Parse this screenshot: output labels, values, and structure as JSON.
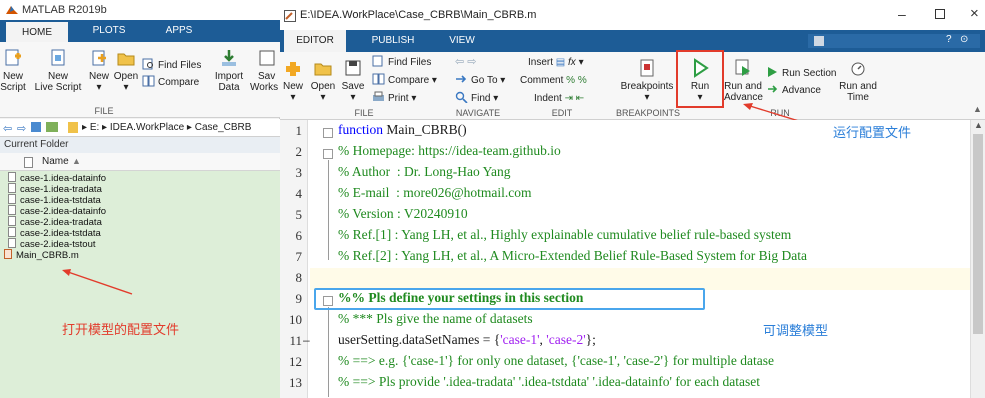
{
  "matlab": {
    "title": "MATLAB R2019b",
    "tabs": [
      "HOME",
      "PLOTS",
      "APPS"
    ],
    "home": {
      "new_script": "New",
      "new_script2": "Script",
      "new_live": "New",
      "new_live2": "Live Script",
      "new": "New",
      "open": "Open",
      "find_files": "Find Files",
      "compare": "Compare",
      "import": "Import",
      "import2": "Data",
      "save_ws": "Sav",
      "save_ws2": "Works",
      "group_file": "FILE"
    },
    "path": [
      "E:",
      "IDEA.WorkPlace",
      "Case_CBRB"
    ],
    "current_folder": "Current Folder",
    "name_header": "Name",
    "files": [
      "case-1.idea-datainfo",
      "case-1.idea-tradata",
      "case-1.idea-tstdata",
      "case-2.idea-datainfo",
      "case-2.idea-tradata",
      "case-2.idea-tstdata",
      "case-2.idea-tstout",
      "Main_CBRB.m"
    ],
    "annotation": "打开模型的配置文件"
  },
  "editor": {
    "title": "E:\\IDEA.WorkPlace\\Case_CBRB\\Main_CBRB.m",
    "tabs": [
      "EDITOR",
      "PUBLISH",
      "VIEW"
    ],
    "ribbon": {
      "new": "New",
      "open": "Open",
      "save": "Save",
      "find_files": "Find Files",
      "compare": "Compare",
      "print": "Print",
      "group_file": "FILE",
      "goto": "Go To",
      "find": "Find",
      "group_nav": "NAVIGATE",
      "insert": "Insert",
      "fx": "fx",
      "comment": "Comment",
      "indent": "Indent",
      "group_edit": "EDIT",
      "breakpoints": "Breakpoints",
      "group_bp": "BREAKPOINTS",
      "run": "Run",
      "run_advance": "Run and",
      "run_advance2": "Advance",
      "run_section": "Run Section",
      "advance": "Advance",
      "run_time": "Run and",
      "run_time2": "Time",
      "group_run": "RUN"
    },
    "line_numbers": [
      "1",
      "2",
      "3",
      "4",
      "5",
      "6",
      "7",
      "8",
      "9",
      "10",
      "11",
      "12",
      "13"
    ],
    "code": {
      "l1_kw": "function",
      "l1": " Main_CBRB()",
      "l2": "% Homepage: https://idea-team.github.io",
      "l3": "% Author  : Dr. Long-Hao Yang",
      "l4": "% E-mail  : more026@hotmail.com",
      "l5": "% Version : V20240910",
      "l6": "% Ref.[1] : Yang LH, et al., Highly explainable cumulative belief rule-based system",
      "l7": "% Ref.[2] : Yang LH, et al., A Micro-Extended Belief Rule-Based System for Big Data",
      "l9": "%% Pls define your settings in this section",
      "l10": "% *** Pls give the name of datasets",
      "l11a": "userSetting.dataSetNames = {",
      "l11b": "'case-1'",
      "l11c": ", ",
      "l11d": "'case-2'",
      "l11e": "};",
      "l12": "% ==> e.g. {'case-1'} for only one dataset, {'case-1', 'case-2'} for multiple datase",
      "l13": "% ==> Pls provide '.idea-tradata' '.idea-tstdata' '.idea-datainfo' for each dataset"
    },
    "annotation_run": "运行配置文件",
    "annotation_adjust": "可调整模型"
  },
  "colors": {
    "tab_bar": "#1d5c96",
    "annotation_red": "#e23b2b",
    "annotation_blue": "#2a7ed8",
    "comment_green": "#1f8a1f",
    "string_purple": "#a020f0",
    "keyword_blue": "#0000ff"
  }
}
